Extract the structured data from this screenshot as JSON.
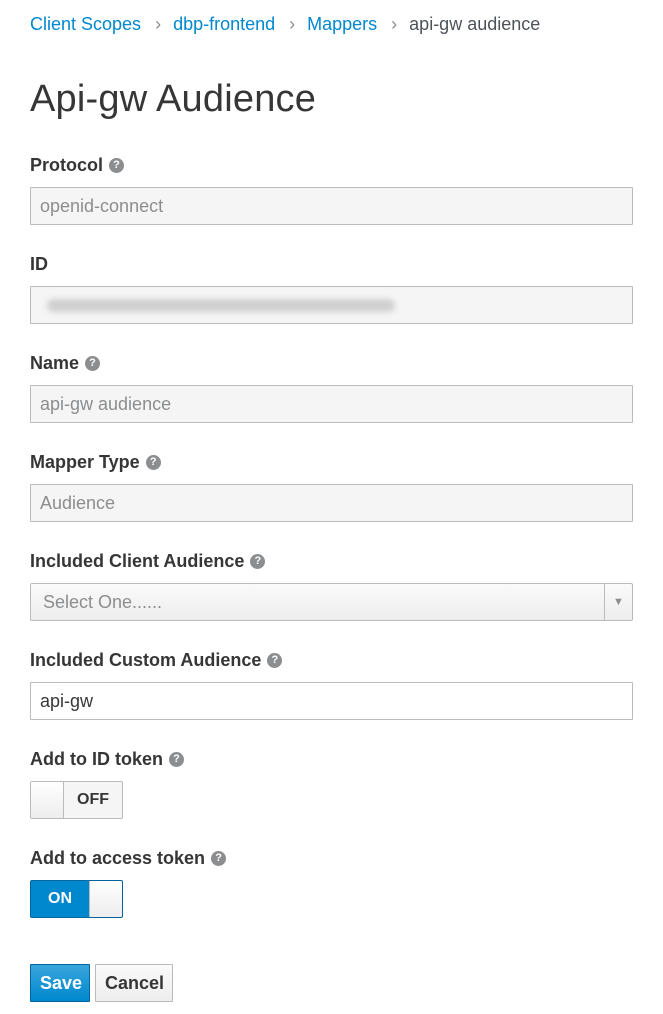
{
  "breadcrumb": {
    "items": [
      "Client Scopes",
      "dbp-frontend",
      "Mappers"
    ],
    "separator": "›",
    "current": "api-gw audience"
  },
  "page_title": "Api-gw Audience",
  "help_icon_glyph": "?",
  "fields": {
    "protocol": {
      "label": "Protocol",
      "value": "openid-connect"
    },
    "id": {
      "label": "ID",
      "value": ""
    },
    "name": {
      "label": "Name",
      "value": "api-gw audience"
    },
    "mapper_type": {
      "label": "Mapper Type",
      "value": "Audience"
    },
    "included_client_audience": {
      "label": "Included Client Audience",
      "placeholder": "Select One......",
      "arrow": "▼"
    },
    "included_custom_audience": {
      "label": "Included Custom Audience",
      "value": "api-gw"
    },
    "add_to_id_token": {
      "label": "Add to ID token",
      "state": "OFF"
    },
    "add_to_access_token": {
      "label": "Add to access token",
      "state": "ON"
    }
  },
  "buttons": {
    "save": "Save",
    "cancel": "Cancel"
  },
  "colors": {
    "link": "#0088ce",
    "primary": "#0088ce",
    "readonly_bg": "#f5f5f5"
  },
  "icons": {
    "help": "question-circle-icon",
    "separator": "chevron-right-icon",
    "dropdown": "caret-down-icon"
  }
}
